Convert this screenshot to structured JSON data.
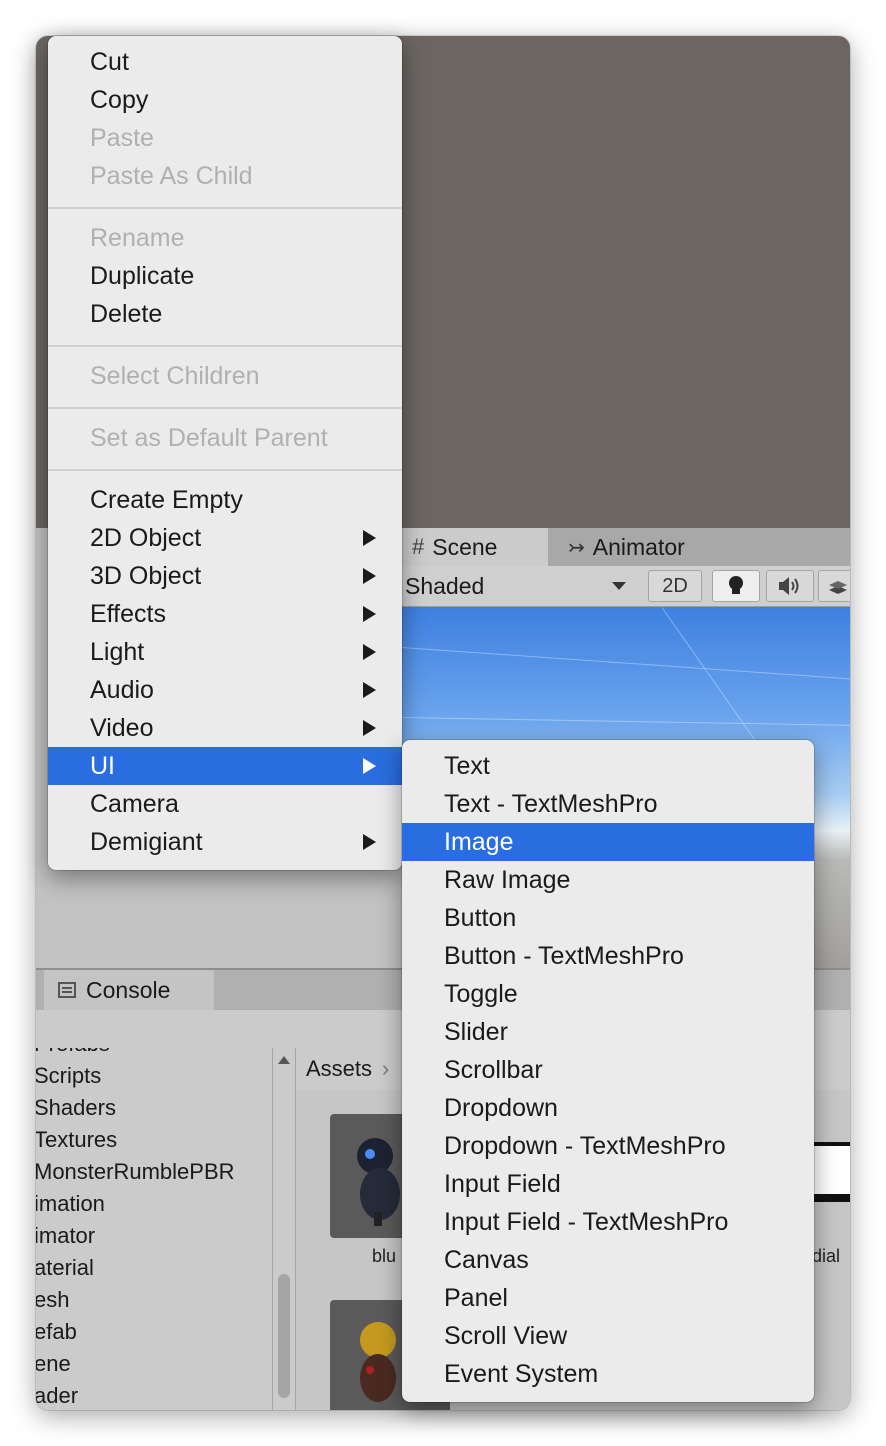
{
  "context_menu": {
    "group1": [
      {
        "label": "Cut",
        "enabled": true
      },
      {
        "label": "Copy",
        "enabled": true
      },
      {
        "label": "Paste",
        "enabled": false
      },
      {
        "label": "Paste As Child",
        "enabled": false
      }
    ],
    "group2": [
      {
        "label": "Rename",
        "enabled": false
      },
      {
        "label": "Duplicate",
        "enabled": true
      },
      {
        "label": "Delete",
        "enabled": true
      }
    ],
    "group3": [
      {
        "label": "Select Children",
        "enabled": false
      }
    ],
    "group4": [
      {
        "label": "Set as Default Parent",
        "enabled": false
      }
    ],
    "group5": [
      {
        "label": "Create Empty",
        "submenu": false
      },
      {
        "label": "2D Object",
        "submenu": true
      },
      {
        "label": "3D Object",
        "submenu": true
      },
      {
        "label": "Effects",
        "submenu": true
      },
      {
        "label": "Light",
        "submenu": true
      },
      {
        "label": "Audio",
        "submenu": true
      },
      {
        "label": "Video",
        "submenu": true
      },
      {
        "label": "UI",
        "submenu": true,
        "selected": true
      },
      {
        "label": "Camera",
        "submenu": false
      },
      {
        "label": "Demigiant",
        "submenu": true
      }
    ]
  },
  "ui_submenu": [
    {
      "label": "Text"
    },
    {
      "label": "Text - TextMeshPro"
    },
    {
      "label": "Image",
      "selected": true
    },
    {
      "label": "Raw Image"
    },
    {
      "label": "Button"
    },
    {
      "label": "Button - TextMeshPro"
    },
    {
      "label": "Toggle"
    },
    {
      "label": "Slider"
    },
    {
      "label": "Scrollbar"
    },
    {
      "label": "Dropdown"
    },
    {
      "label": "Dropdown - TextMeshPro"
    },
    {
      "label": "Input Field"
    },
    {
      "label": "Input Field - TextMeshPro"
    },
    {
      "label": "Canvas"
    },
    {
      "label": "Panel"
    },
    {
      "label": "Scroll View"
    },
    {
      "label": "Event System"
    }
  ],
  "scene_tabs": {
    "scene": "Scene",
    "animator": "Animator"
  },
  "scene_toolbar": {
    "shading_mode": "Shaded",
    "mode_2d": "2D"
  },
  "console": {
    "tab_label": "Console"
  },
  "project_tree": [
    "Prefabs",
    "Scripts",
    "Shaders",
    "Textures",
    "MonsterRumblePBR",
    "imation",
    "imator",
    "aterial",
    "esh",
    "efab",
    "ene",
    "ader"
  ],
  "assets": {
    "breadcrumb": "Assets",
    "thumb_labels": [
      "blu",
      "dial"
    ]
  },
  "colors": {
    "selection": "#2a6de0",
    "menu_bg": "#ebebeb",
    "disabled_text": "#b0b0b0"
  }
}
